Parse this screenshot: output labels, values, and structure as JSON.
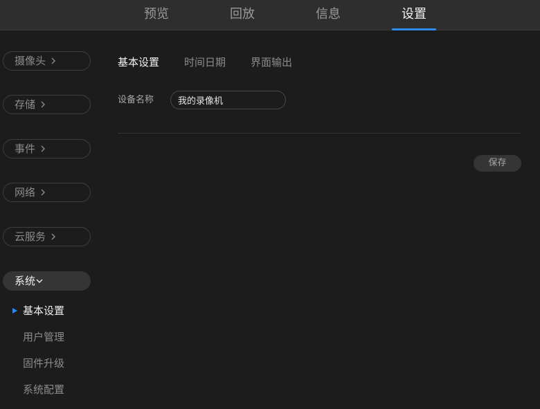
{
  "top_nav": {
    "tabs": [
      {
        "label": "预览"
      },
      {
        "label": "回放"
      },
      {
        "label": "信息"
      },
      {
        "label": "设置"
      }
    ],
    "active_index": 3
  },
  "sidebar": {
    "sections": [
      {
        "label": "摄像头"
      },
      {
        "label": "存储"
      },
      {
        "label": "事件"
      },
      {
        "label": "网络"
      },
      {
        "label": "云服务"
      },
      {
        "label": "系统"
      }
    ],
    "system_items": [
      {
        "label": "基本设置"
      },
      {
        "label": "用户管理"
      },
      {
        "label": "固件升级"
      },
      {
        "label": "系统配置"
      }
    ]
  },
  "content": {
    "tabs": [
      {
        "label": "基本设置"
      },
      {
        "label": "时间日期"
      },
      {
        "label": "界面输出"
      }
    ],
    "device_name_label": "设备名称",
    "device_name_value": "我的录像机",
    "save_label": "保存"
  },
  "colors": {
    "accent": "#2c8cf0",
    "background": "#1c1c1c",
    "topbar": "#2e2e2e"
  }
}
